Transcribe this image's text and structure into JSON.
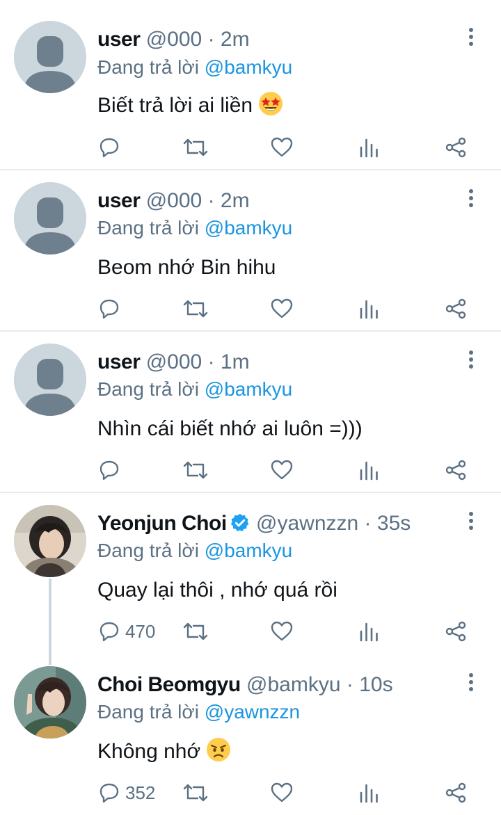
{
  "tweets": [
    {
      "name": "user",
      "handle": "@000",
      "separator": "·",
      "time": "2m",
      "reply_prefix": "Đang trả lời",
      "reply_to": "@bamkyu",
      "text": "Biết trả lời ai liền",
      "emoji": "star-struck-emoji",
      "verified": false,
      "reply_count": ""
    },
    {
      "name": "user",
      "handle": "@000",
      "separator": "·",
      "time": "2m",
      "reply_prefix": "Đang trả lời",
      "reply_to": "@bamkyu",
      "text": "Beom nhớ Bin hihu",
      "verified": false,
      "reply_count": ""
    },
    {
      "name": "user",
      "handle": "@000",
      "separator": "·",
      "time": "1m",
      "reply_prefix": "Đang trả lời",
      "reply_to": "@bamkyu",
      "text": "Nhìn cái biết nhớ ai luôn =)))",
      "verified": false,
      "reply_count": ""
    },
    {
      "name": "Yeonjun Choi",
      "handle": "@yawnzzn",
      "separator": "·",
      "time": "35s",
      "reply_prefix": "Đang trả lời",
      "reply_to": "@bamkyu",
      "text": "Quay lại thôi , nhớ quá rồi",
      "verified": true,
      "reply_count": "470"
    },
    {
      "name": "Choi Beomgyu",
      "handle": "@bamkyu",
      "separator": "·",
      "time": "10s",
      "reply_prefix": "Đang trả lời",
      "reply_to": "@yawnzzn",
      "text": "Không nhớ",
      "emoji": "angry-face-emoji",
      "verified": false,
      "reply_count": "352"
    }
  ],
  "colors": {
    "text": "#0f1419",
    "secondary": "#5b7083",
    "link": "#1b95e0",
    "verified": "#1da1f2",
    "divider": "#e6ecf0",
    "default_avatar_bg": "#ccd6dd",
    "default_avatar_fg": "#6e7f8d"
  }
}
